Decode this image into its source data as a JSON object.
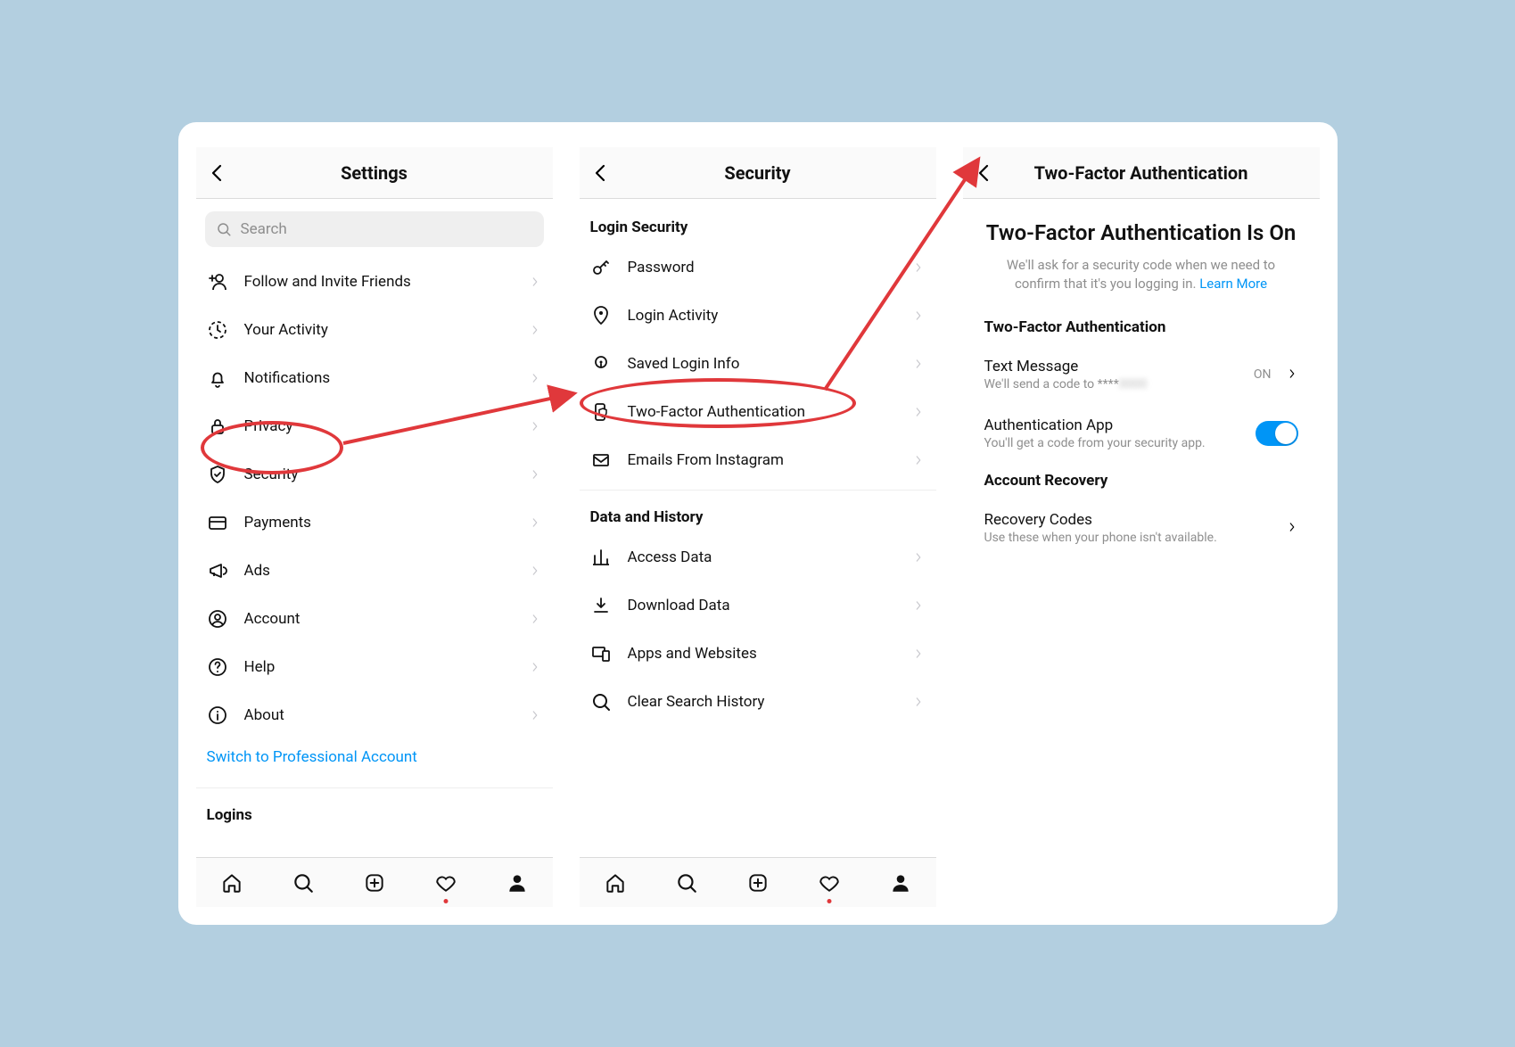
{
  "panel1": {
    "title": "Settings",
    "search_placeholder": "Search",
    "items": [
      {
        "label": "Follow and Invite Friends",
        "icon": "user-plus-icon"
      },
      {
        "label": "Your Activity",
        "icon": "activity-clock-icon"
      },
      {
        "label": "Notifications",
        "icon": "bell-icon"
      },
      {
        "label": "Privacy",
        "icon": "lock-icon"
      },
      {
        "label": "Security",
        "icon": "shield-check-icon"
      },
      {
        "label": "Payments",
        "icon": "credit-card-icon"
      },
      {
        "label": "Ads",
        "icon": "megaphone-icon"
      },
      {
        "label": "Account",
        "icon": "account-circle-icon"
      },
      {
        "label": "Help",
        "icon": "help-circle-icon"
      },
      {
        "label": "About",
        "icon": "info-circle-icon"
      }
    ],
    "switch_link": "Switch to Professional Account",
    "logins_section": "Logins"
  },
  "panel2": {
    "title": "Security",
    "sections": [
      {
        "title": "Login Security",
        "items": [
          {
            "label": "Password",
            "icon": "key-icon"
          },
          {
            "label": "Login Activity",
            "icon": "location-pin-icon"
          },
          {
            "label": "Saved Login Info",
            "icon": "keyhole-icon"
          },
          {
            "label": "Two-Factor Authentication",
            "icon": "phone-shield-icon"
          },
          {
            "label": "Emails From Instagram",
            "icon": "mail-icon"
          }
        ]
      },
      {
        "title": "Data and History",
        "items": [
          {
            "label": "Access Data",
            "icon": "bar-chart-icon"
          },
          {
            "label": "Download Data",
            "icon": "download-icon"
          },
          {
            "label": "Apps and Websites",
            "icon": "devices-icon"
          },
          {
            "label": "Clear Search History",
            "icon": "search-icon"
          }
        ]
      }
    ]
  },
  "panel3": {
    "title": "Two-Factor Authentication",
    "heading": "Two-Factor Authentication Is On",
    "desc_line1": "We'll ask for a security code when we need to",
    "desc_line2": "confirm that it's you logging in.",
    "learn_more": "Learn More",
    "section1": "Two-Factor Authentication",
    "text_message": {
      "title": "Text Message",
      "sub_prefix": "We'll send a code to ****",
      "sub_blur": "0000",
      "state": "ON"
    },
    "auth_app": {
      "title": "Authentication App",
      "sub": "You'll get a code from your security app.",
      "toggle_on": true
    },
    "section2": "Account Recovery",
    "recovery": {
      "title": "Recovery Codes",
      "sub": "Use these when your phone isn't available."
    }
  },
  "tabbar": {
    "icons": [
      "home-icon",
      "search-icon",
      "add-post-icon",
      "heart-icon",
      "profile-filled-icon"
    ],
    "activity_dot_on_heart": true
  }
}
